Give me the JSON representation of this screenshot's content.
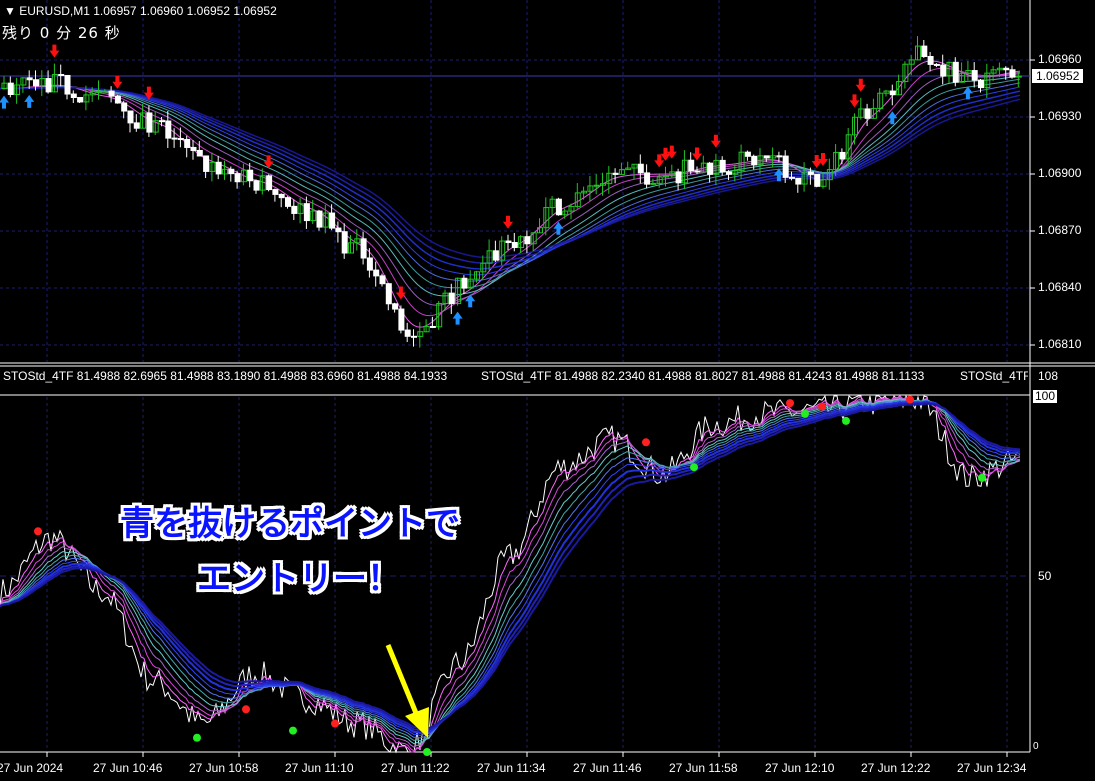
{
  "header": {
    "symbol_line": "EURUSD,M1  1.06957 1.06960 1.06952 1.06952",
    "countdown": "残り 0 分 26 秒"
  },
  "price_axis": {
    "labels": [
      "1.06960",
      "1.06930",
      "1.06900",
      "1.06870",
      "1.06840",
      "1.06810"
    ],
    "current_price": "1.06952"
  },
  "indicator": {
    "label_1": "STOStd_4TF 81.4988 82.6965 81.4988 83.1890 81.4988 83.6960 81.4988 84.1933",
    "label_2": "STOStd_4TF 81.4988 82.2340 81.4988 81.8027 81.4988 81.4243 81.4988 81.1133",
    "label_3": "STOStd_4TF",
    "axis_labels": [
      "108",
      "100",
      "50",
      "0"
    ]
  },
  "time_axis": [
    "27 Jun 2024",
    "27 Jun 10:46",
    "27 Jun 10:58",
    "27 Jun 11:10",
    "27 Jun 11:22",
    "27 Jun 11:34",
    "27 Jun 11:46",
    "27 Jun 11:58",
    "27 Jun 12:10",
    "27 Jun 12:22",
    "27 Jun 12:34"
  ],
  "annotation": {
    "line1": "青を抜けるポイントで",
    "line2": "エントリー！"
  },
  "colors": {
    "background": "#000000",
    "bull_candle": "#22c322",
    "bear_candle": "#ffffff",
    "sell_arrow": "#ff1010",
    "buy_arrow": "#1e90ff",
    "grid": "#1c1c6e",
    "annotation_text": "#0a14ff",
    "pointer_arrow": "#ffff00"
  },
  "chart_data": {
    "type": "line",
    "price_series": {
      "time": [
        "10:34",
        "10:40",
        "10:46",
        "10:52",
        "10:58",
        "11:04",
        "11:10",
        "11:16",
        "11:22",
        "11:28",
        "11:34",
        "11:40",
        "11:46",
        "11:52",
        "11:58",
        "12:04",
        "12:10",
        "12:16",
        "12:22",
        "12:28",
        "12:34"
      ],
      "close": [
        1.06945,
        1.06947,
        1.0694,
        1.06925,
        1.06905,
        1.06895,
        1.0688,
        1.0686,
        1.06815,
        1.0684,
        1.06865,
        1.06885,
        1.069,
        1.069,
        1.06905,
        1.06908,
        1.06895,
        1.06935,
        1.06962,
        1.0695,
        1.06955
      ]
    },
    "stochastic_series": {
      "time": [
        "10:34",
        "10:40",
        "10:46",
        "10:52",
        "10:58",
        "11:04",
        "11:10",
        "11:16",
        "11:22",
        "11:28",
        "11:34",
        "11:40",
        "11:46",
        "11:52",
        "11:58",
        "12:04",
        "12:10",
        "12:16",
        "12:22",
        "12:28",
        "12:34"
      ],
      "value": [
        45,
        60,
        45,
        20,
        8,
        22,
        15,
        8,
        0,
        25,
        55,
        80,
        88,
        78,
        92,
        95,
        96,
        98,
        99,
        77,
        82
      ]
    },
    "stochastic_ylim": [
      0,
      108
    ]
  }
}
